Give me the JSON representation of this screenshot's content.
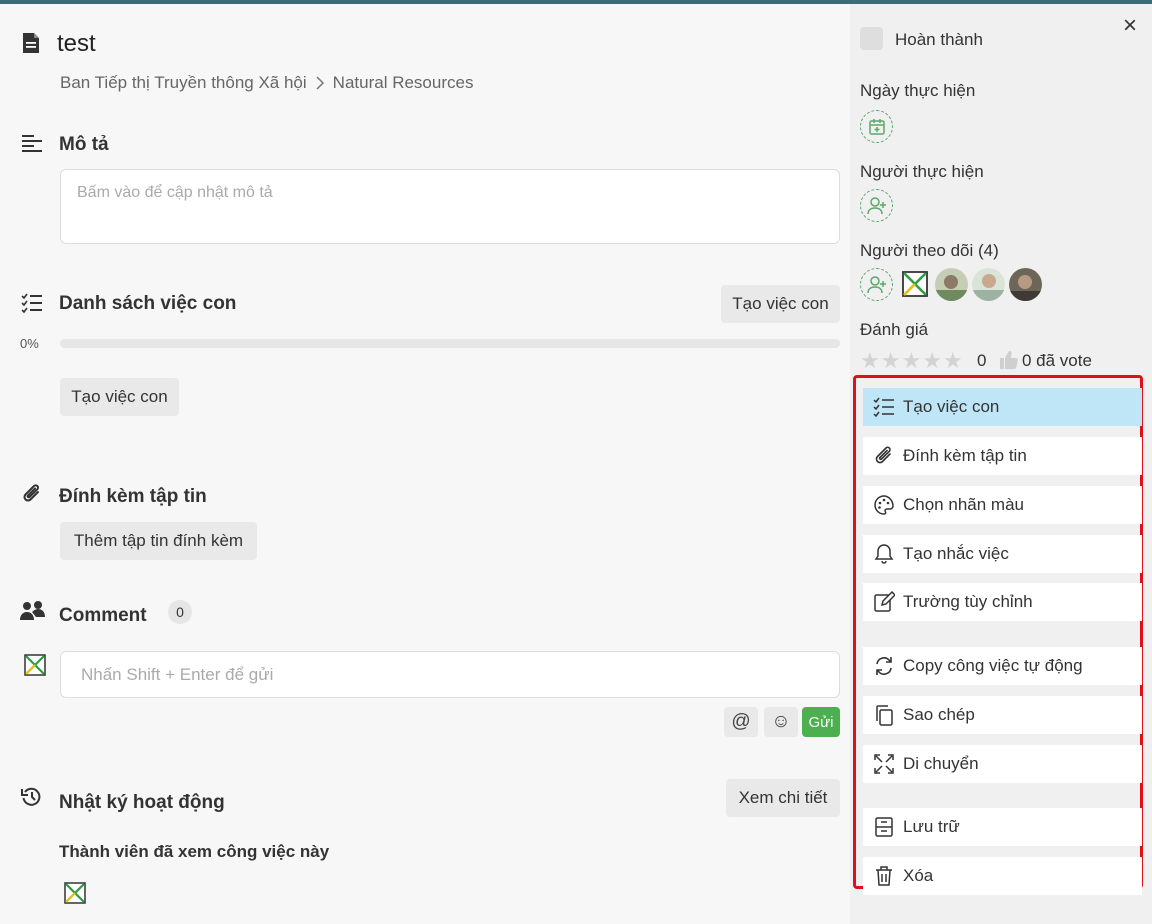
{
  "task": {
    "title": "test",
    "breadcrumb": [
      "Ban Tiếp thị Truyền thông Xã hội",
      "Natural Resources"
    ]
  },
  "description": {
    "title": "Mô tả",
    "placeholder": "Bấm vào để cập nhật mô tả"
  },
  "subtasks": {
    "title": "Danh sách việc con",
    "header_button": "Tạo việc con",
    "progress_label": "0%",
    "progress": 0,
    "add_button": "Tạo việc con"
  },
  "attachments": {
    "title": "Đính kèm tập tin",
    "add_button": "Thêm tập tin đính kèm"
  },
  "comment": {
    "title": "Comment",
    "count": "0",
    "placeholder": "Nhấn Shift + Enter để gửi",
    "mention_label": "@",
    "emoji_label": "☺",
    "send_label": "Gửi"
  },
  "activity": {
    "title": "Nhật ký hoạt động",
    "detail_button": "Xem chi tiết",
    "viewers_title": "Thành viên đã xem công việc này"
  },
  "sidebar": {
    "close_label": "×",
    "complete_label": "Hoàn thành",
    "date_label": "Ngày thực hiện",
    "assignee_label": "Người thực hiện",
    "followers_label": "Người theo dõi (4)",
    "rating_label": "Đánh giá",
    "rating_value": "0",
    "vote_text": "0 đã vote",
    "stars": 5
  },
  "actions": [
    {
      "label": "Tạo việc con",
      "icon": "checklist-icon",
      "active": true
    },
    {
      "label": "Đính kèm tập tin",
      "icon": "paperclip-icon",
      "active": false
    },
    {
      "label": "Chọn nhãn màu",
      "icon": "palette-icon",
      "active": false
    },
    {
      "label": "Tạo nhắc việc",
      "icon": "bell-icon",
      "active": false
    },
    {
      "label": "Trường tùy chỉnh",
      "icon": "edit-icon",
      "active": false
    },
    {
      "label": "Copy công việc tự động",
      "icon": "repeat-icon",
      "active": false
    },
    {
      "label": "Sao chép",
      "icon": "copy-icon",
      "active": false
    },
    {
      "label": "Di chuyển",
      "icon": "move-icon",
      "active": false
    },
    {
      "label": "Lưu trữ",
      "icon": "archive-icon",
      "active": false
    },
    {
      "label": "Xóa",
      "icon": "trash-icon",
      "active": false
    }
  ],
  "colors": {
    "accent_green": "#4caf50",
    "highlight_blue": "#bfe6f7",
    "annotation_red": "#e0101a"
  }
}
